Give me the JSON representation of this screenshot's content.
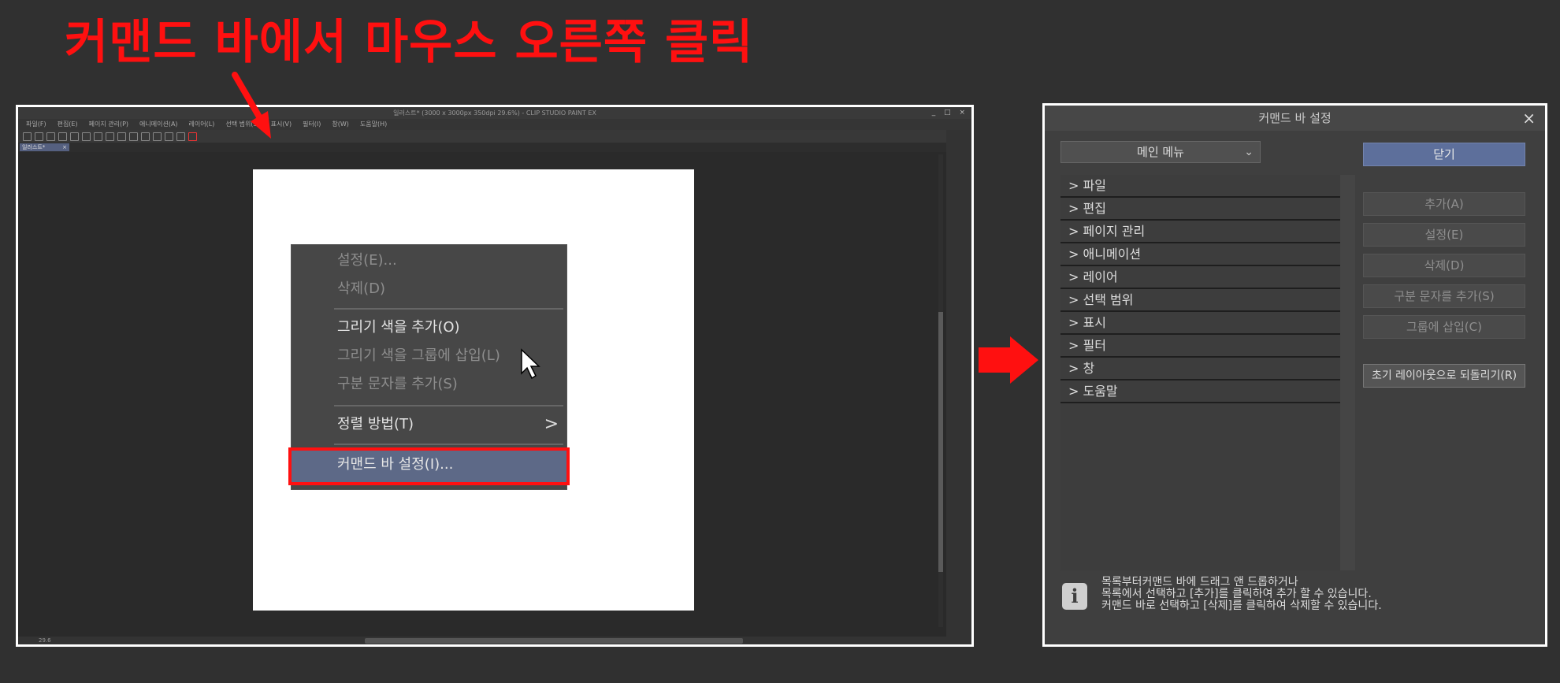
{
  "headline": "커맨드 바에서 마우스 오른쪽 클릭",
  "app": {
    "title": "일러스트* (3000 x 3000px 350dpi 29.6%) - CLIP STUDIO PAINT EX",
    "window_controls": "_ □ ×",
    "menubar": [
      "파일(F)",
      "편집(E)",
      "페이지 관리(P)",
      "애니메이션(A)",
      "레이어(L)",
      "선택 범위(S)",
      "표시(V)",
      "필터(I)",
      "창(W)",
      "도움말(H)"
    ],
    "document_tab": "일러스트*",
    "document_tab_close": "×",
    "status": "29.6"
  },
  "context_menu": {
    "settings": "설정(E)...",
    "delete": "삭제(D)",
    "add_draw_color": "그리기 색을 추가(O)",
    "insert_draw_color_group": "그리기 색을 그룹에 삽입(L)",
    "add_separator": "구분 문자를 추가(S)",
    "sort": "정렬 방법(T)",
    "sort_arrow": ">",
    "command_bar_settings": "커맨드 바 설정(I)..."
  },
  "dialog": {
    "title": "커맨드 바 설정",
    "close_glyph": "×",
    "dropdown_value": "메인 메뉴",
    "dropdown_chevron": "⌄",
    "menu_items": [
      "> 파일",
      "> 편집",
      "> 페이지 관리",
      "> 애니메이션",
      "> 레이어",
      "> 선택 범위",
      "> 표시",
      "> 필터",
      "> 창",
      "> 도움말"
    ],
    "buttons": {
      "close": "닫기",
      "add": "추가(A)",
      "settings": "설정(E)",
      "delete": "삭제(D)",
      "add_separator": "구분 문자를 추가(S)",
      "insert_group": "그룹에 삽입(C)",
      "reset_layout": "초기 레이아웃으로 되돌리기(R)"
    },
    "info_icon": "i",
    "info_lines": [
      "목록부터커맨드 바에 드래그 앤 드롭하거나",
      "목록에서 선택하고 [추가]를 클릭하여 추가 할 수 있습니다.",
      "커맨드 바로 선택하고 [삭제]를 클릭하여 삭제할 수 있습니다."
    ]
  },
  "colors": {
    "annotation_red": "#ff1010",
    "accent_blue": "#5d6f9b",
    "highlight_item": "#5d6987",
    "background": "#303030"
  },
  "icons": {
    "pointer_arrow": "annotation-arrow",
    "cursor": "mouse-cursor-icon",
    "flow_arrow": "right-arrow-icon",
    "info": "info-icon"
  }
}
